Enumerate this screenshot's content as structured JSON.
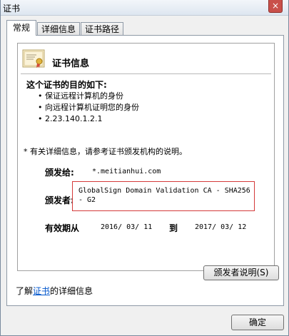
{
  "window": {
    "title": "证书",
    "close_label": "×"
  },
  "tabs": [
    {
      "label": "常规"
    },
    {
      "label": "详细信息"
    },
    {
      "label": "证书路径"
    }
  ],
  "cert": {
    "header_title": "证书信息",
    "purpose_title": "这个证书的目的如下:",
    "purposes": [
      "保证远程计算机的身份",
      "向远程计算机证明您的身份",
      "2.23.140.1.2.1"
    ],
    "note": "* 有关详细信息，请参考证书颁发机构的说明。",
    "issued_to_label": "颁发给:",
    "issued_to_value": "*.meitianhui.com",
    "issued_by_label": "颁发者:",
    "issued_by_line1": "GlobalSign Domain Validation CA - SHA256",
    "issued_by_line2": "- G2",
    "valid_label": "有效期从",
    "valid_from": "2016/  03/  11",
    "to_label": "到",
    "valid_to": "2017/  03/  12"
  },
  "buttons": {
    "issuer_statement": "颁发者说明(S)",
    "ok": "确定"
  },
  "learn_more": {
    "prefix": "了解",
    "link": "证书",
    "suffix": "的详细信息"
  }
}
